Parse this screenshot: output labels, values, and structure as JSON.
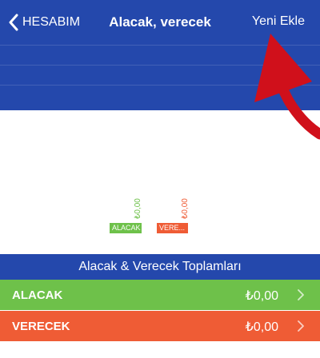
{
  "nav": {
    "back_label": "HESABIM",
    "title": "Alacak, verecek",
    "add_label": "Yeni Ekle"
  },
  "chart_data": {
    "type": "bar",
    "categories": [
      "ALACAK",
      "VERE..."
    ],
    "values": [
      0,
      0
    ],
    "value_labels": [
      "₺0,00",
      "₺0,00"
    ],
    "colors": [
      "#6ec14a",
      "#ef5c35"
    ]
  },
  "totals": {
    "header": "Alacak & Verecek Toplamları",
    "rows": [
      {
        "label": "ALACAK",
        "amount": "₺0,00",
        "color": "#6ec14a"
      },
      {
        "label": "VERECEK",
        "amount": "₺0,00",
        "color": "#ef5c35"
      }
    ]
  },
  "colors": {
    "brand_blue": "#2448ac",
    "annotation_red": "#d0101b"
  }
}
